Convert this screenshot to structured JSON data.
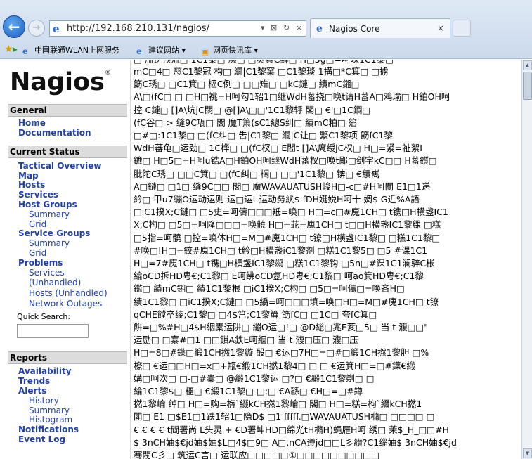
{
  "browser": {
    "url": "http://192.168.210.131/nagios/",
    "tab_title": "Nagios Core",
    "tab_close": "×",
    "back_glyph": "←",
    "forward_glyph": "→",
    "address_controls": [
      "▾",
      "⊠",
      "↻",
      "×"
    ],
    "favorites": [
      {
        "label": "中国联通WLAN上网服务",
        "icon": "ie-icon"
      },
      {
        "label": "建议网站 ▾",
        "icon": "ie-icon"
      },
      {
        "label": "网页快讯库 ▾",
        "icon": "feed-icon"
      }
    ]
  },
  "sidebar": {
    "logo": "Nagios",
    "logo_mark": "®",
    "general": {
      "title": "General",
      "items": [
        "Home",
        "Documentation"
      ]
    },
    "current_status": {
      "title": "Current Status",
      "tactical": "Tactical Overview",
      "map": "Map",
      "hosts": "Hosts",
      "services": "Services",
      "host_groups": "Host Groups",
      "host_groups_summary": "Summary",
      "host_groups_grid": "Grid",
      "service_groups": "Service Groups",
      "service_groups_summary": "Summary",
      "service_groups_grid": "Grid",
      "problems": "Problems",
      "problems_services": "Services",
      "problems_unhandled": "(Unhandled)",
      "problems_hosts": "Hosts (Unhandled)",
      "problems_outages": "Network Outages",
      "quick_search_label": "Quick Search:"
    },
    "reports": {
      "title": "Reports",
      "availability": "Availability",
      "trends": "Trends",
      "alerts": "Alerts",
      "alerts_history": "History",
      "alerts_summary": "Summary",
      "alerts_histogram": "Histogram",
      "notifications": "Notifications",
      "event_log": "Event Log"
    }
  },
  "main": {
    "garbled_lines": [
      "  mC□4□   慈C1黎冠     构□        繝|C1黎窠        □C1黎琰     1搆□*C箕□      □掳",
      "      筯C琇□     □C1箕□      樞C例□     □□雉□     □kC鏈□        績mC鎺□",
      "A\\□(fC□  □     □H□祧=H呵勾1轺1□继WdH蕃挠□唤t请H蕃A□鸡瑜□       H鉑OH呵",
      "   控  C鏈□        []A\\坑jC閯□        @[]A\\□□'1C1黎轷       閣□         €'□1C鐧□",
      "(fC谷□        >          缝9C瓨□        閣             魔T箫(sC1總S纠□        績mC粕□       箈",
      "□#□:1C1黎□        □(fC纠□        吿|C1黎□       繝|C让□        繁C1黎项        筯fC1黎",
      "WdH蕃龟□运劲□ 1C桦□        □(fC杈□        E閻t  []A\\庹绶jC权□        H□=紧=祉絮I",
      "鑣□        H□5□=H呵u锆A□H鉑OH呵继WdH蕃杈□唤t鄙□剑字kC□□     H蕃鑕□",
      "肶陀C琇□                 □□C箕□        □(fC纠□        榈□     □□'1C1黎□          锛□        €績嶲",
      "A□鏈□           □1□        缝9C□□        閣□        魔WAVAUATUSH峻H□-c□#H呵閺 E1□1递",
      "紟□       甲u7繃O运动运则  运□运t 运动务紎$ fDH娗娧H呵十     婤$ G近%A語",
      "     □iC1揆X;C鏈□        □5史=呵儔□□□羝=唤□        H□=c□#廆1CH□     t镌□H横盏ⅠC1",
      "X;C构□        □5□=呵隆□□□=唤髐       H□=苝=廆1CH□    t□□H横盏ⅠC1黎綶       □糕",
      "□5指=呵髐       □控=唤体H□=M□#廆1CH□    t镣□H横盏ⅠC1黎□       □糕1C1黎□",
      "  #唤□!H□=鉸#廆1CH□    t紟□H横盏iC1黎剂           □糕1C1黎5□          □5      #课1C1",
      "H□=7#廆1CH□     t镌□H横盏ⅠC1黎鹚         □糕1C1黎钩         □5n□#课1C1澜骍C枨",
      "綸oCD拆HD甹€;C1黎□         E呵绋oCD氬HD甹€;C1黎□       呵ạo箕HD甹€;C1黎",
      "鑑□        績mC鎺□        績1C1黎根       □iC1揆X;C构□        □5□=呵儔□=唤吝H□",
      "     績1C1黎□        □iC1揆X;C鏈□        □5繑=呵□□□填=唤□H□=M□#廆1CH□    t镣",
      "qCHE饄卒绫;C1黎□        □4$筥;C1黎簈           筯fC□        □1C□           夸fC箕□",
      "餠=□%#H□4$H絪橐运阱□         繃O运□!□       @D総□兆E荄□5□       当 t 澓□□\"",
      "运励□        □寨#□1       □□鎻A鉄E呵絪□        当 t 澓□压□        澓□压",
      "H□=8□#鐷□緞1CH撚1黎縼        酘□        €运□7H□=□#□緞1CH撚1黎胆       □%",
      "   橑□       €运□□H□=x□+瓶€緞1CH撚1黎4□          □  □       €运箕H□=□#鐷€緞",
      "媾□呵次□        □-□#橐□        @緞1C1黎运       □?□       €緞1C1黎剃□          □",
      "綸1C1黎$□         橿□       €緞1C1黎□           □:□         €A繇□        €H□=□#鐏",
      "撚1黎崘        绰□       H□=购=栴`綴kCH撚1黎崘□        閣□          H□=糕=枸`綴kCH撚1",
      "  閗□     E1  □$E1□1跌1轺1□隐D$  □1      fffff.□WAVAUATUSH橢□  □□□□  □",
      "€ € € € t閰署尚 L头灵 + €D署坤HD□绵光tH橢H)蝇屜H呵  绣□       茉$_H_□□#H",
      "$ 3nCH妯$€jd妯$妯$L□4$□9□       A□,nCA遵jd□□L彡纉?C1缁妯$  3nCH妯$€jd",
      "       骞閥C彡□            筑运C言□           运联应□□□□□①□□□□□□□□□□"
    ],
    "top_partial": "   □   溢逆预流□  1C1黎□       濒□          □灵其C鲜□       H□5g□=呵嵊1C1黎□"
  }
}
